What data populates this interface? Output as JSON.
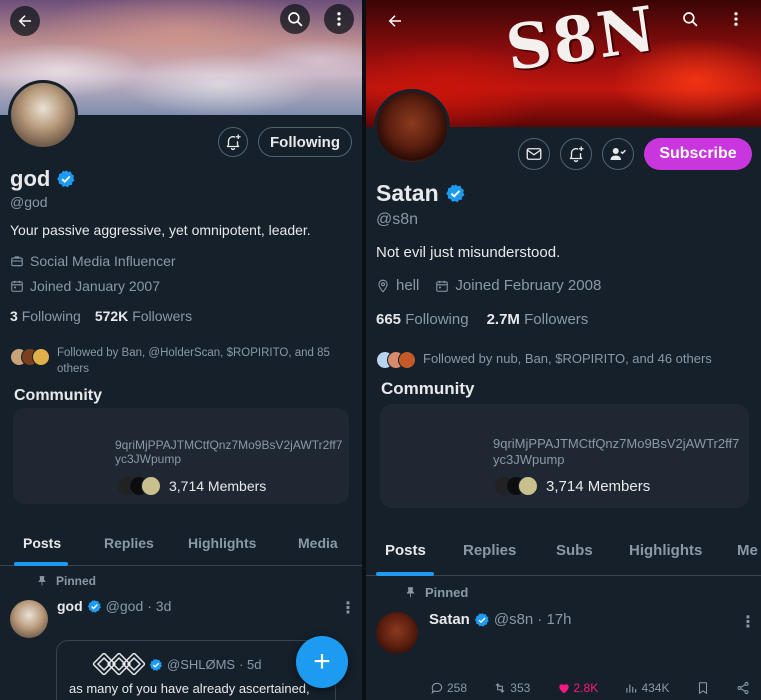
{
  "left": {
    "name": "god",
    "handle": "@god",
    "bio": "Your passive aggressive, yet omnipotent, leader.",
    "category": "Social Media Influencer",
    "joined": "Joined January 2007",
    "following_count": "3",
    "following_label": "Following",
    "followers_count": "572K",
    "followers_label": "Followers",
    "followed_by": "Followed by Ban, @HolderScan, $ROPIRITO, and 85 others",
    "follow_button": "Following",
    "community_title": "Community",
    "community_text": "9qriMjPPAJTMCtfQnz7Mo9BsV2jAWTr2ff7yc3JWpump",
    "members": "3,714 Members",
    "tabs": [
      "Posts",
      "Replies",
      "Highlights",
      "Media"
    ],
    "pinned": "Pinned",
    "post": {
      "name": "god",
      "handle": "@god",
      "time": "· 3d"
    },
    "quote": {
      "name": "@SHLØMS",
      "time": "· 5d",
      "text": "as many of you have already ascertained,"
    }
  },
  "right": {
    "banner_text": "S8N",
    "name": "Satan",
    "handle": "@s8n",
    "bio": "Not evil just misunderstood.",
    "location": "hell",
    "joined": "Joined February 2008",
    "following_count": "665",
    "following_label": "Following",
    "followers_count": "2.7M",
    "followers_label": "Followers",
    "followed_by": "Followed by nub, Ban, $ROPIRITO, and 46 others",
    "subscribe_button": "Subscribe",
    "community_title": "Community",
    "community_text": "9qriMjPPAJTMCtfQnz7Mo9BsV2jAWTr2ff7yc3JWpump",
    "members": "3,714 Members",
    "tabs": [
      "Posts",
      "Replies",
      "Subs",
      "Highlights",
      "Me"
    ],
    "pinned": "Pinned",
    "post": {
      "name": "Satan",
      "handle": "@s8n",
      "time": "· 17h"
    },
    "actions": {
      "replies": "258",
      "reposts": "353",
      "likes": "2.8K",
      "views": "434K"
    }
  },
  "colors": {
    "accent": "#1d9bf0",
    "subscribe": "#c936dd",
    "like": "#f91880",
    "background": "#15202b"
  },
  "icons": [
    "back-arrow-icon",
    "search-icon",
    "more-vertical-icon",
    "bell-plus-icon",
    "mail-icon",
    "person-check-icon",
    "verified-badge-icon",
    "briefcase-icon",
    "calendar-icon",
    "location-pin-icon",
    "pin-icon",
    "plus-icon",
    "reply-icon",
    "repost-icon",
    "heart-icon",
    "views-icon",
    "bookmark-icon",
    "share-icon"
  ]
}
